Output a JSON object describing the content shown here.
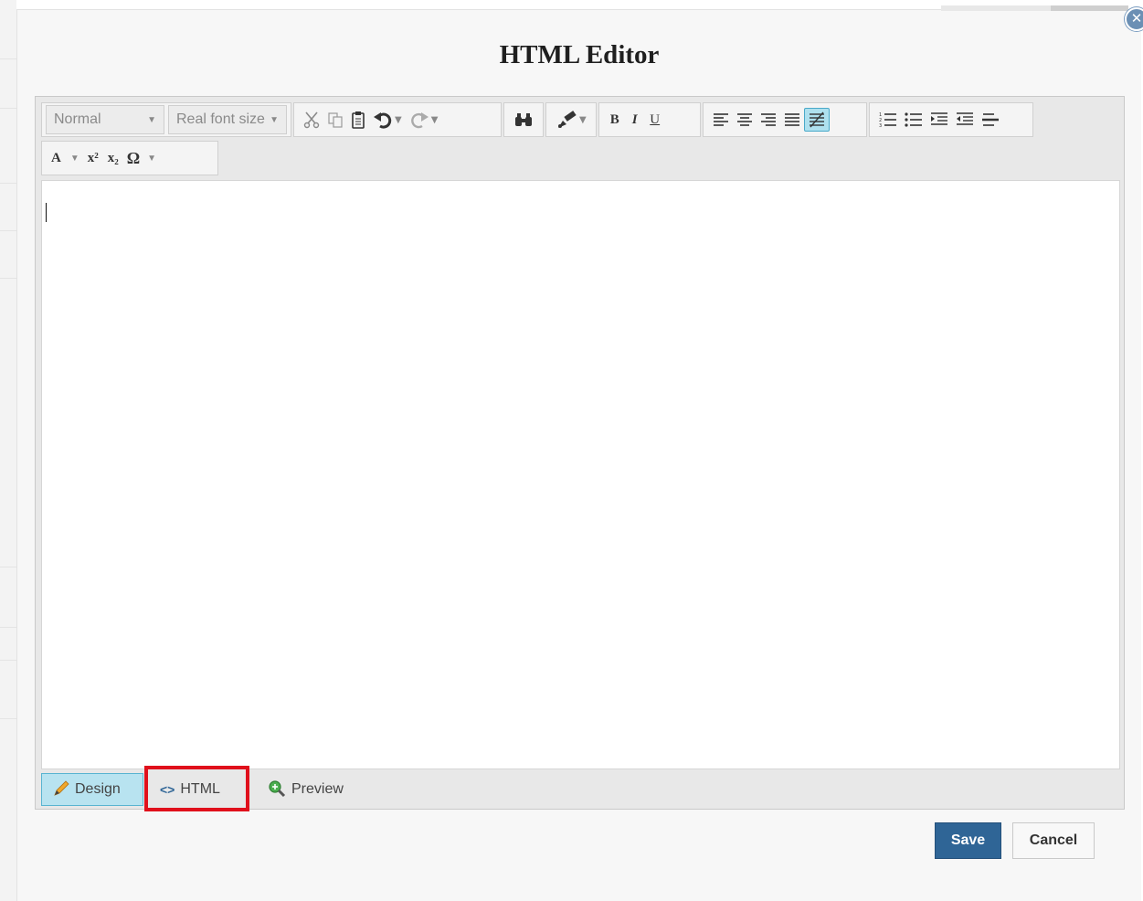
{
  "dialog": {
    "title": "HTML Editor",
    "close_icon": "close-icon"
  },
  "toolbar": {
    "format_dropdown": "Normal",
    "font_size_dropdown": "Real font size",
    "buttons": {
      "cut": "scissors-icon",
      "copy": "copy-icon",
      "paste": "clipboard-icon",
      "undo": "undo-icon",
      "redo": "redo-icon",
      "find": "binoculars-icon",
      "format_painter": "paintbrush-icon",
      "bold": "B",
      "italic": "I",
      "underline": "U",
      "align_left": "align-left-icon",
      "align_center": "align-center-icon",
      "align_right": "align-right-icon",
      "justify": "justify-icon",
      "remove_alignment": "remove-alignment-icon",
      "ordered_list": "ordered-list-icon",
      "unordered_list": "unordered-list-icon",
      "indent": "indent-icon",
      "outdent": "outdent-icon",
      "horizontal_rule": "horizontal-rule-icon",
      "font_color": "A",
      "superscript": "x²",
      "subscript": "x₂",
      "special_chars": "Ω"
    }
  },
  "mode_tabs": {
    "design": "Design",
    "html": "HTML",
    "preview": "Preview"
  },
  "actions": {
    "save": "Save",
    "cancel": "Cancel"
  },
  "colors": {
    "save_button": "#2f6596",
    "active_tab": "#b8e3f0",
    "highlight": "#e0101c"
  }
}
